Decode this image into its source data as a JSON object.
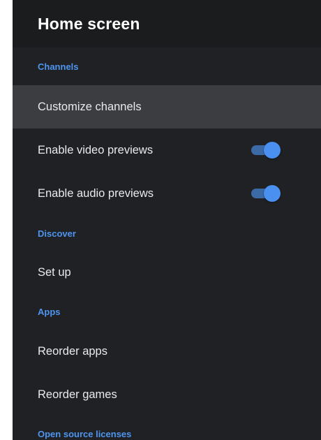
{
  "header": {
    "title": "Home screen"
  },
  "sections": {
    "channels": {
      "label": "Channels",
      "customize": "Customize channels",
      "video_previews": {
        "label": "Enable video previews",
        "enabled": true
      },
      "audio_previews": {
        "label": "Enable audio previews",
        "enabled": true
      }
    },
    "discover": {
      "label": "Discover",
      "setup": "Set up"
    },
    "apps": {
      "label": "Apps",
      "reorder_apps": "Reorder apps",
      "reorder_games": "Reorder games"
    },
    "licenses": {
      "label": "Open source licenses"
    }
  },
  "colors": {
    "background": "#202124",
    "header_background": "#1b1c1e",
    "focused_row": "#3b3d40",
    "section_accent": "#4e95ef",
    "toggle_on": "#4a90f0"
  }
}
